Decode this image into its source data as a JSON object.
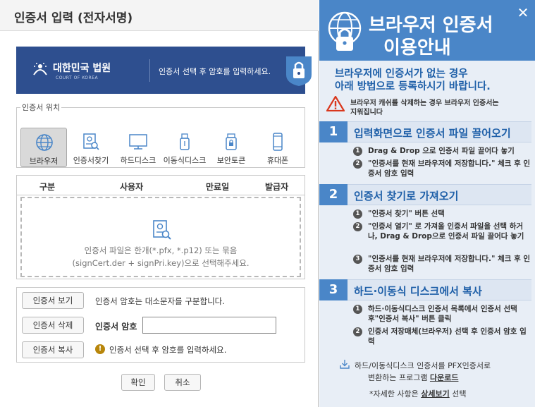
{
  "dialog": {
    "title": "인증서 입력 (전자서명)",
    "banner": {
      "org": "대한민국 법원",
      "org_sub": "COURT OF KOREA",
      "message": "인증서 선택 후 암호를 입력하세요."
    },
    "location": {
      "legend": "인증서 위치",
      "items": [
        {
          "label": "브라우저",
          "icon": "globe-icon",
          "selected": true
        },
        {
          "label": "인증서찾기",
          "icon": "find-cert-icon",
          "selected": false
        },
        {
          "label": "하드디스크",
          "icon": "monitor-icon",
          "selected": false
        },
        {
          "label": "이동식디스크",
          "icon": "usb-icon",
          "selected": false
        },
        {
          "label": "보안토큰",
          "icon": "token-icon",
          "selected": false
        },
        {
          "label": "휴대폰",
          "icon": "phone-icon",
          "selected": false
        }
      ]
    },
    "table": {
      "columns": [
        "구분",
        "사용자",
        "만료일",
        "발급자"
      ],
      "drop_line1": "인증서 파일은 한개(*.pfx, *.p12) 또는 묶음",
      "drop_line2": "(signCert.der + signPri.key)으로 선택해주세요."
    },
    "actions": {
      "view_label": "인증서 보기",
      "delete_label": "인증서 삭제",
      "copy_label": "인증서 복사",
      "case_info": "인증서 암호는 대소문자를 구분합니다.",
      "password_label": "인증서 암호",
      "password_value": "",
      "warning": "인증서 선택 후 암호를 입력하세요."
    },
    "ok_label": "확인",
    "cancel_label": "취소"
  },
  "help": {
    "title_line1": "브라우저 인증서",
    "title_line2": "이용안내",
    "close_glyph": "✕",
    "subtitle_line1": "브라우저에 인증서가 없는 경우",
    "subtitle_line2": "아래 방법으로 등록하시기 바랍니다.",
    "alert_line1": "브라우저 캐쉬를 삭제하는 경우 브라우저 인증서는",
    "alert_line2": "지워집니다",
    "sections": [
      {
        "num": "1",
        "title": "입력화면으로 인증서 파일 끌어오기",
        "steps": [
          {
            "n": "1",
            "text": "Drag & Drop 으로 인증서 파일 끌어다 놓기"
          },
          {
            "n": "2",
            "text": "\"인증서를 현재 브라우저에 저장합니다.\" 체크 후 인증서 암호 입력"
          }
        ]
      },
      {
        "num": "2",
        "title": "인증서 찾기로 가져오기",
        "steps": [
          {
            "n": "1",
            "text": "\"인증서 찾기\" 버튼 선택"
          },
          {
            "n": "2",
            "text": "\"인증서 열기\" 로 가져올 인증서 파일을 선택 하거나, Drag & Drop으로 인증서 파일 끌어다 놓기"
          },
          {
            "n": "3",
            "text": "\"인증서를 현재 브라우저에 저장합니다.\" 체크 후 인증서 암호 입력"
          }
        ]
      },
      {
        "num": "3",
        "title": "하드·이동식 디스크에서 복사",
        "steps": [
          {
            "n": "1",
            "text": "하드·이동식디스크 인증서 목록에서 인증서 선택 후\"인증서 복사\" 버튼 클릭"
          },
          {
            "n": "2",
            "text": "인증서 저장매체(브라우저) 선택 후 인증서 암호 입력"
          }
        ]
      }
    ],
    "download_line1": "하드/이동식디스크 인증서를 PFX인증서로",
    "download_line2_pre": "변환하는 프로그램 ",
    "download_link": "다운로드",
    "more_pre": "*자세한 사항은 ",
    "more_link": "상세보기",
    "more_post": " 선택"
  },
  "colors": {
    "banner": "#2e4f8f",
    "accent": "#4a86c8",
    "accent_text": "#1e5fa8",
    "alert": "#d9381e"
  }
}
